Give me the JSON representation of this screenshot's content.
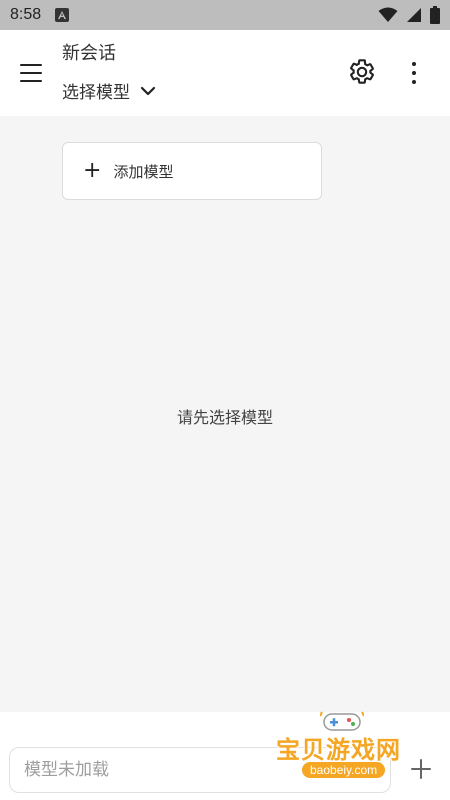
{
  "status_bar": {
    "time": "8:58",
    "notification_icon": "a-icon",
    "right_icons": [
      "wifi-icon",
      "signal-icon",
      "battery-icon"
    ]
  },
  "app_bar": {
    "title": "新会话",
    "model_select_label": "选择模型",
    "menu_icon": "menu-icon",
    "settings_icon": "gear-icon",
    "more_icon": "more-vertical-icon"
  },
  "main": {
    "add_model_label": "添加模型",
    "empty_hint": "请先选择模型"
  },
  "input_bar": {
    "placeholder": "模型未加载",
    "value": ""
  },
  "watermark": {
    "text": "宝贝游戏网",
    "url": "baobeiy.com"
  },
  "colors": {
    "status_bar_bg": "#bdbdbd",
    "main_bg": "#f5f5f5",
    "watermark_accent": "#f5a623"
  }
}
